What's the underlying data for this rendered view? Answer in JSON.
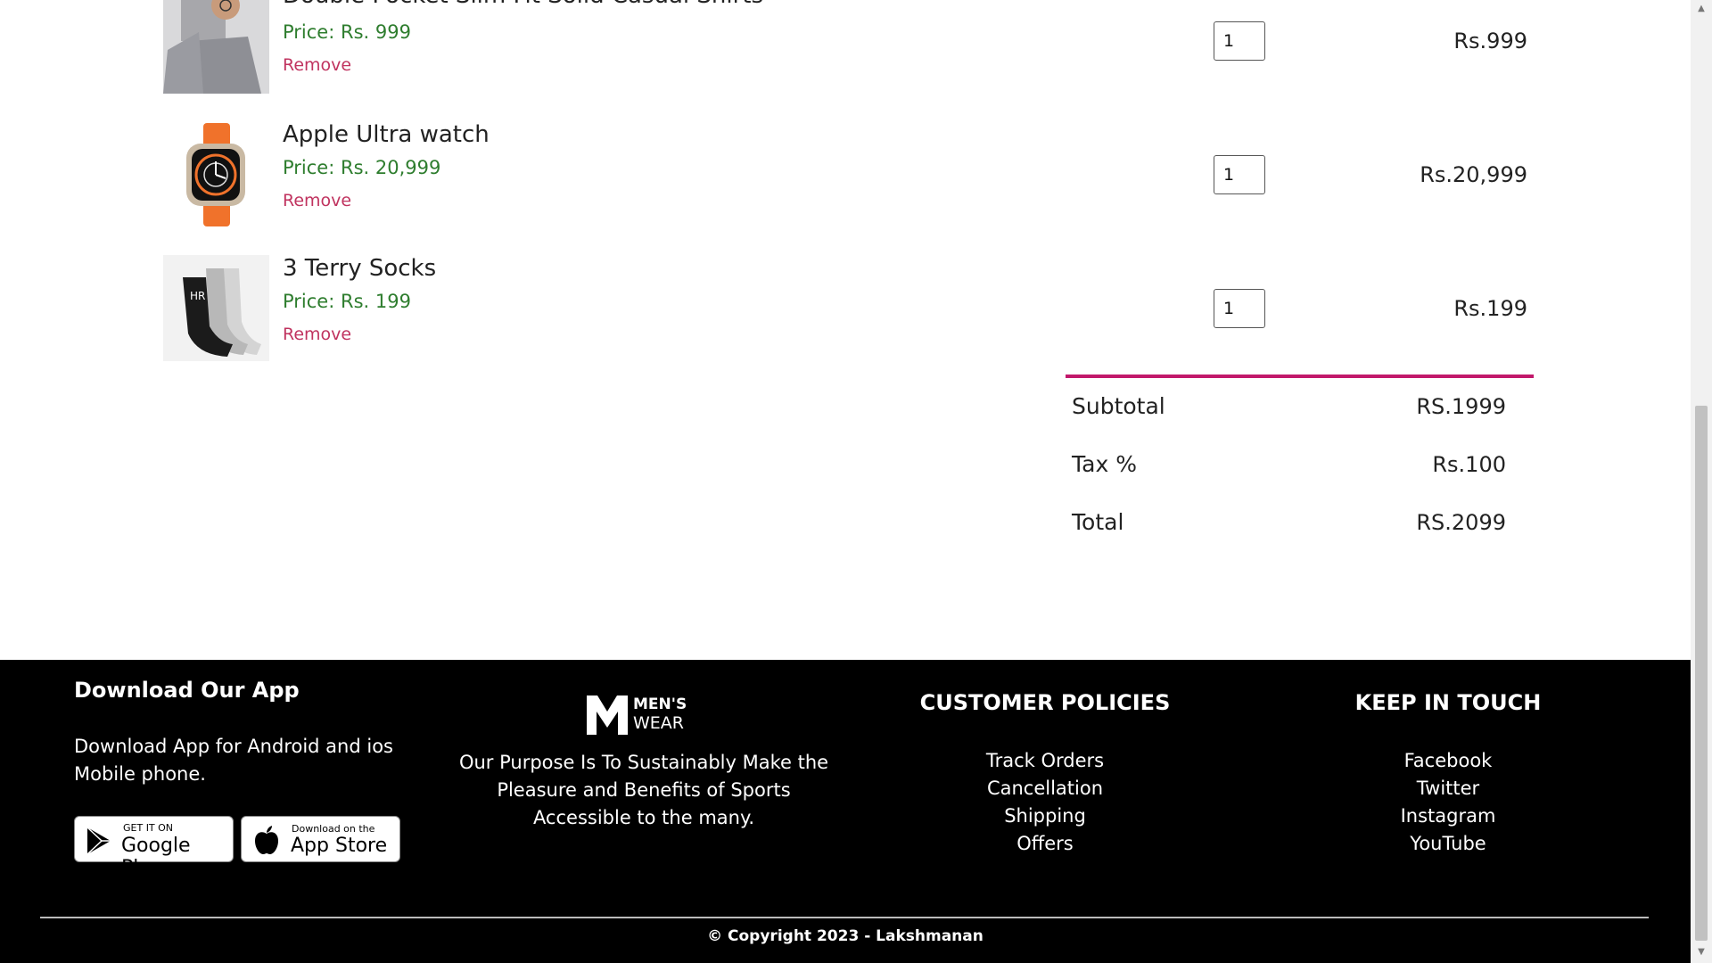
{
  "cart": {
    "items": [
      {
        "name": "Double Pocket Slim Fit Solid Casual Shirts",
        "price": "Price: Rs. 999",
        "remove": "Remove",
        "qty": "1",
        "total": "Rs.999",
        "image": "shirt-model"
      },
      {
        "name": "Apple Ultra watch",
        "price": "Price: Rs. 20,999",
        "remove": "Remove",
        "qty": "1",
        "total": "Rs.20,999",
        "image": "watch-orange-band"
      },
      {
        "name": "3 Terry Socks",
        "price": "Price: Rs. 199",
        "remove": "Remove",
        "qty": "1",
        "total": "Rs.199",
        "image": "socks-pack"
      }
    ],
    "summary": {
      "subtotal_label": "Subtotal",
      "subtotal_value": "RS.1999",
      "tax_label": "Tax %",
      "tax_value": "Rs.100",
      "total_label": "Total",
      "total_value": "RS.2099"
    }
  },
  "footer": {
    "app": {
      "title": "Download Our App",
      "text_line1": "Download App for Android and ios",
      "text_line2": "Mobile phone.",
      "google_small": "GET IT ON",
      "google_big": "Google Play",
      "apple_small": "Download on the",
      "apple_big": "App Store"
    },
    "brand": {
      "logo_top": "MEN'S",
      "logo_bottom": "WEAR",
      "line1": "Our Purpose Is To Sustainably Make the",
      "line2": "Pleasure and Benefits of Sports",
      "line3": "Accessible to the many."
    },
    "policies": {
      "title": "CUSTOMER POLICIES",
      "links": [
        "Track Orders",
        "Cancellation",
        "Shipping",
        "Offers"
      ]
    },
    "touch": {
      "title": "KEEP IN TOUCH",
      "links": [
        "Facebook",
        "Twitter",
        "Instagram",
        "YouTube"
      ]
    },
    "copyright": "© Copyright 2023 - Lakshmanan"
  },
  "colors": {
    "accent": "#c2186b",
    "price_green": "#2e7d2e",
    "remove_pink": "#c0335f",
    "footer_bg": "#000000"
  }
}
